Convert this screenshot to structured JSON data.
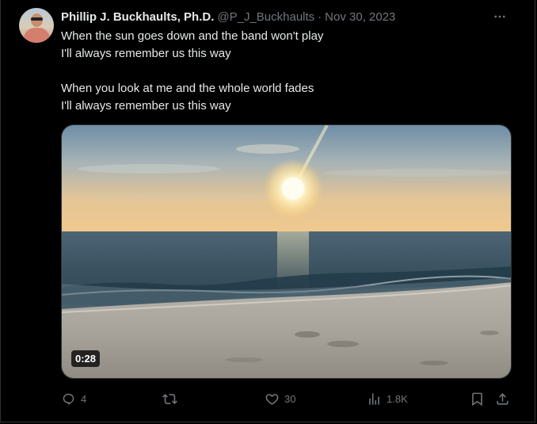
{
  "tweet": {
    "author": {
      "display_name": "Phillip J. Buckhaults, Ph.D.",
      "handle": "@P_J_Buckhaults",
      "avatar": "avatar-photo"
    },
    "separator": "·",
    "date": "Nov 30, 2023",
    "text_lines": [
      "When the sun goes down and the band won't play",
      "I'll always remember us this way",
      "When you look at me and the whole world fades",
      "I'll always remember us this way"
    ],
    "media": {
      "description_icon": "beach-sunset-video",
      "duration": "0:28"
    },
    "actions": {
      "reply": {
        "icon": "reply-icon",
        "count": "4"
      },
      "retweet": {
        "icon": "retweet-icon",
        "count": ""
      },
      "like": {
        "icon": "heart-icon",
        "count": "30"
      },
      "views": {
        "icon": "views-icon",
        "count": "1.8K"
      },
      "bookmark": {
        "icon": "bookmark-icon"
      },
      "share": {
        "icon": "share-icon"
      }
    },
    "more_icon": "more-options-icon"
  },
  "colors": {
    "background": "#000000",
    "text_primary": "#e7e9ea",
    "text_secondary": "#71767b",
    "border": "#2f3336"
  }
}
